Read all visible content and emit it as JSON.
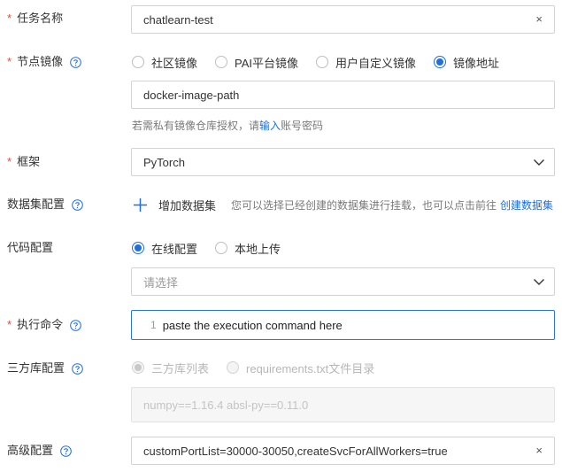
{
  "task_name": {
    "label": "任务名称",
    "value": "chatlearn-test",
    "clear_icon": "×"
  },
  "node_image": {
    "label": "节点镜像",
    "options": [
      "社区镜像",
      "PAI平台镜像",
      "用户自定义镜像",
      "镜像地址"
    ],
    "selected_index": 3,
    "value": "docker-image-path",
    "hint_prefix": "若需私有镜像仓库授权，请",
    "hint_link": "输入",
    "hint_suffix": "账号密码"
  },
  "framework": {
    "label": "框架",
    "value": "PyTorch"
  },
  "dataset": {
    "label": "数据集配置",
    "add_icon": "+",
    "add_label": "增加数据集",
    "description": "您可以选择已经创建的数据集进行挂载，也可以点击前往",
    "create_link": "创建数据集"
  },
  "code": {
    "label": "代码配置",
    "options": [
      "在线配置",
      "本地上传"
    ],
    "selected_index": 0,
    "select_placeholder": "请选择"
  },
  "command": {
    "label": "执行命令",
    "line_number": "1",
    "value": "paste the execution command here"
  },
  "third_party": {
    "label": "三方库配置",
    "options": [
      "三方库列表",
      "requirements.txt文件目录"
    ],
    "selected_index": 0,
    "placeholder": "numpy==1.16.4 absl-py==0.11.0"
  },
  "advanced": {
    "label": "高级配置",
    "value": "customPortList=30000-30050,createSvcForAllWorkers=true",
    "clear_icon": "×"
  },
  "colors": {
    "accent": "#1f6fde",
    "required": "#e84c3d",
    "border": "#d3d3d3",
    "focus_border": "#2e73d6"
  }
}
